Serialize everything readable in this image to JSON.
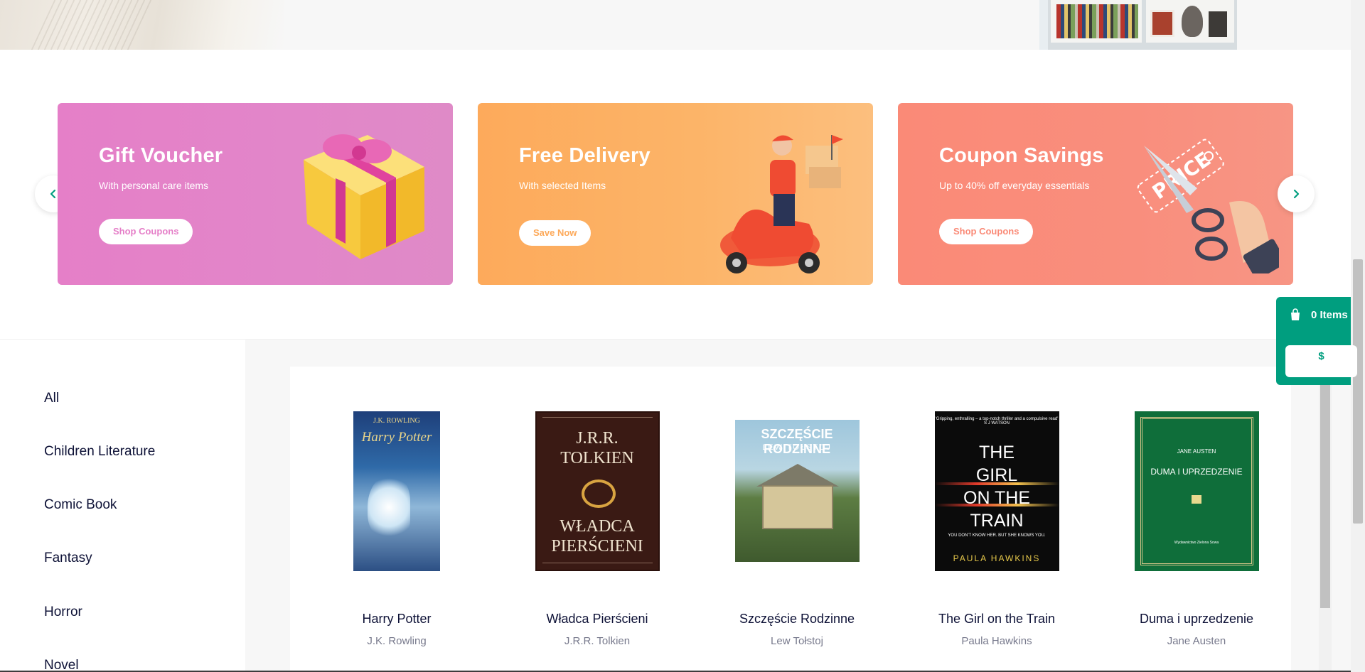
{
  "promos": [
    {
      "title": "Gift Voucher",
      "subtitle": "With personal care items",
      "button": "Shop Coupons",
      "color": "#e57fc8"
    },
    {
      "title": "Free Delivery",
      "subtitle": "With selected Items",
      "button": "Save Now",
      "color": "#fdaa5b"
    },
    {
      "title": "Coupon Savings",
      "subtitle": "Up to 40% off everyday essentials",
      "button": "Shop Coupons",
      "color": "#fa8a77"
    }
  ],
  "promo_art": {
    "price_tag": "PRICE"
  },
  "categories": [
    "All",
    "Children Literature",
    "Comic Book",
    "Fantasy",
    "Horror",
    "Novel"
  ],
  "books": [
    {
      "title": "Harry Potter",
      "author": "J.K. Rowling",
      "cover_lines": [
        "J.K. ROWLING",
        "Harry Potter"
      ]
    },
    {
      "title": "Władca Pierścieni",
      "author": "J.R.R. Tolkien",
      "cover_lines": [
        "J.R.R.",
        "TOLKIEN",
        "WŁADCA",
        "PIERŚCIENI"
      ]
    },
    {
      "title": "Szczęście Rodzinne",
      "author": "Lew Tołstoj",
      "cover_lines": [
        "SZCZĘŚCIE RODZINNE",
        "LEW TOŁSTOJ"
      ]
    },
    {
      "title": "The Girl on the Train",
      "author": "Paula Hawkins",
      "cover_lines": [
        "'Gripping, enthralling – a top-notch thriller and a compulsive read' S J WATSON",
        "THE",
        "GIRL",
        "ON THE",
        "TRAIN",
        "YOU DON'T KNOW HER. BUT SHE KNOWS YOU.",
        "PAULA HAWKINS"
      ]
    },
    {
      "title": "Duma i uprzedzenie",
      "author": "Jane Austen",
      "cover_lines": [
        "JANE AUSTEN",
        "DUMA I UPRZEDZENIE",
        "Wydawnictwo Zielona Sowa"
      ]
    }
  ],
  "cart": {
    "items_label": "0 Items",
    "price": "$",
    "accent": "#009e7f"
  },
  "colors": {
    "text_dark": "#0d1136",
    "text_muted": "#77798c",
    "arrow_accent": "#009e7f"
  }
}
